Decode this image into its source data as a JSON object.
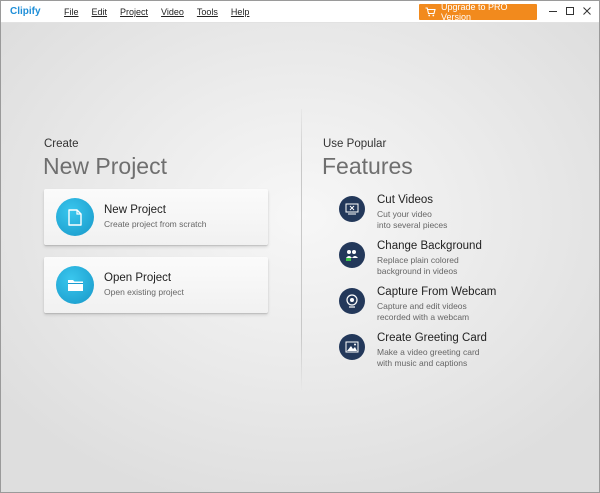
{
  "app": {
    "name": "Clipify",
    "colors": {
      "brand": "#1f8fd8",
      "upgrade": "#f28a1d",
      "card_icon": "#1aa0d6",
      "feature_icon": "#23385a"
    }
  },
  "menu": {
    "items": [
      {
        "label": "File"
      },
      {
        "label": "Edit"
      },
      {
        "label": "Project"
      },
      {
        "label": "Video"
      },
      {
        "label": "Tools"
      },
      {
        "label": "Help"
      }
    ]
  },
  "upgrade": {
    "label": "Upgrade to PRO Version",
    "icon": "cart-icon"
  },
  "window_controls": {
    "icons": [
      "minimize-icon",
      "maximize-icon",
      "close-icon"
    ]
  },
  "create": {
    "small_title": "Create",
    "big_title": "New Project",
    "cards": [
      {
        "title": "New Project",
        "subtitle": "Create project from scratch",
        "icon": "document-icon"
      },
      {
        "title": "Open Project",
        "subtitle": "Open existing project",
        "icon": "folder-icon"
      }
    ]
  },
  "features": {
    "small_title": "Use Popular",
    "big_title": "Features",
    "items": [
      {
        "title": "Cut Videos",
        "desc1": "Cut your video",
        "desc2": "into several pieces",
        "icon": "cut-video-icon"
      },
      {
        "title": "Change Background",
        "desc1": "Replace plain colored",
        "desc2": "background in videos",
        "icon": "chroma-key-icon"
      },
      {
        "title": "Capture From Webcam",
        "desc1": "Capture and edit videos",
        "desc2": "recorded with a webcam",
        "icon": "webcam-icon"
      },
      {
        "title": "Create Greeting Card",
        "desc1": "Make a video greeting card",
        "desc2": "with music and captions",
        "icon": "picture-icon"
      }
    ]
  }
}
